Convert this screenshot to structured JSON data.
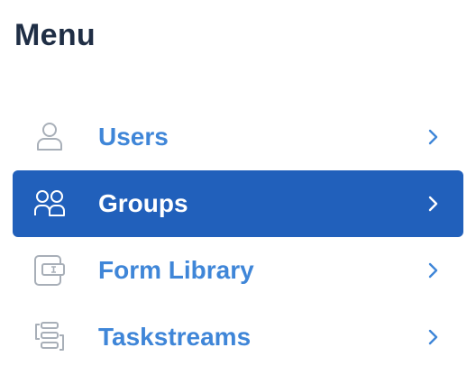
{
  "menu": {
    "title": "Menu",
    "items": [
      {
        "label": "Users",
        "icon": "user-icon",
        "active": false
      },
      {
        "label": "Groups",
        "icon": "group-icon",
        "active": true
      },
      {
        "label": "Form Library",
        "icon": "form-library-icon",
        "active": false
      },
      {
        "label": "Taskstreams",
        "icon": "taskstreams-icon",
        "active": false
      }
    ]
  },
  "colors": {
    "title": "#1f2e45",
    "accent": "#2160bb",
    "link": "#3f86d8",
    "icon_inactive": "#a8afb8",
    "active_text": "#ffffff"
  }
}
